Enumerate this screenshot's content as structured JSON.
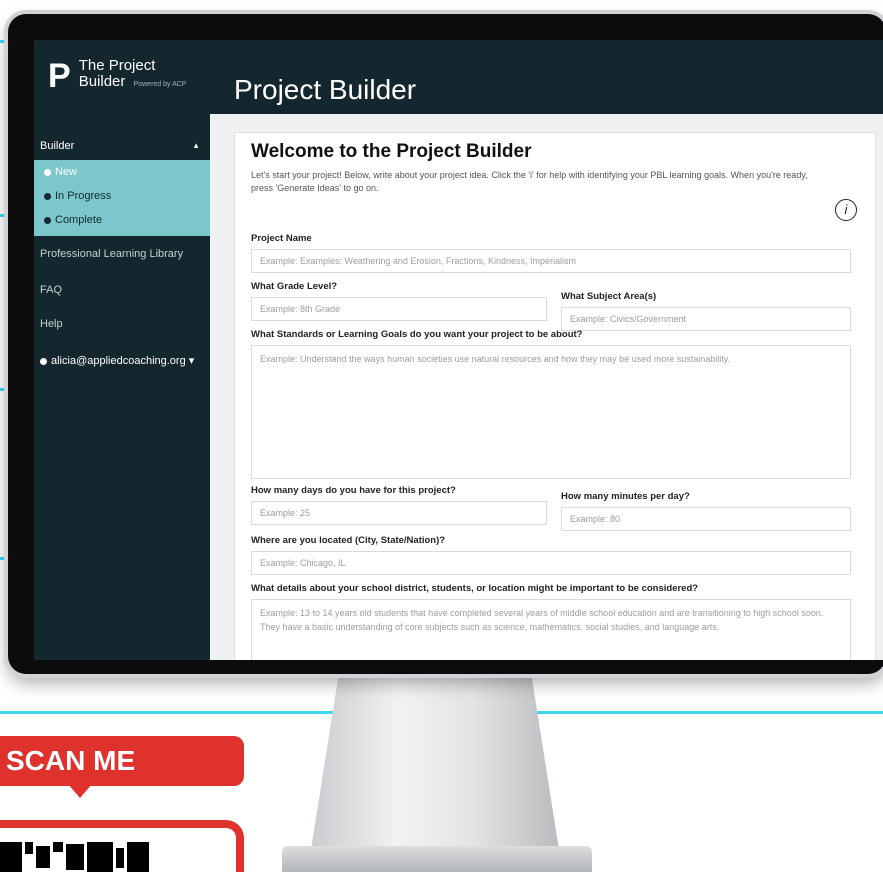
{
  "sidebar": {
    "logo_line1": "The Project",
    "logo_line2": "Builder",
    "logo_sub": "Powered by ACP",
    "section": "Builder",
    "sub_items": [
      {
        "label": "New"
      },
      {
        "label": "In Progress"
      },
      {
        "label": "Complete"
      }
    ],
    "links": [
      {
        "label": "Professional Learning Library"
      },
      {
        "label": "FAQ"
      },
      {
        "label": "Help"
      }
    ],
    "user": "alicia@appliedcoaching.org"
  },
  "header": {
    "title": "Project Builder"
  },
  "form": {
    "heading": "Welcome to the Project Builder",
    "intro": "Let's start your project! Below, write about your project idea. Click the 'i' for help with identifying your PBL learning goals. When you're ready, press 'Generate Ideas' to go on.",
    "info_icon": "i",
    "project_name": {
      "label": "Project Name",
      "placeholder": "Example: Examples: Weathering and Erosion, Fractions, Kindness, Imperialism"
    },
    "grade": {
      "label": "What Grade Level?",
      "placeholder": "Example: 8th Grade"
    },
    "subject": {
      "label": "What Subject Area(s)",
      "placeholder": "Example: Civics/Government"
    },
    "standards": {
      "label": "What Standards or Learning Goals do you want your project to be about?",
      "placeholder": "Example: Understand the ways human societies use natural resources and how they may be used more sustainability."
    },
    "days": {
      "label": "How many days do you have for this project?",
      "placeholder": "Example: 25"
    },
    "minutes": {
      "label": "How many minutes per day?",
      "placeholder": "Example: 80"
    },
    "location": {
      "label": "Where are you located (City, State/Nation)?",
      "placeholder": "Example: Chicago, IL"
    },
    "details": {
      "label": "What details about your school district, students, or location might be important to be considered?",
      "placeholder": "Example: 13 to 14 years old students that have completed several years of middle school education and are transitioning to high school soon. They have a basic understanding of core subjects such as science, mathematics, social studies, and language arts."
    }
  },
  "promo": {
    "scan_label": "SCAN ME"
  },
  "colors": {
    "sidebar_bg": "#14272e",
    "submenu_bg": "#7cc7cb",
    "accent_red": "#e0322d",
    "accent_cyan": "#3fd6ee"
  }
}
